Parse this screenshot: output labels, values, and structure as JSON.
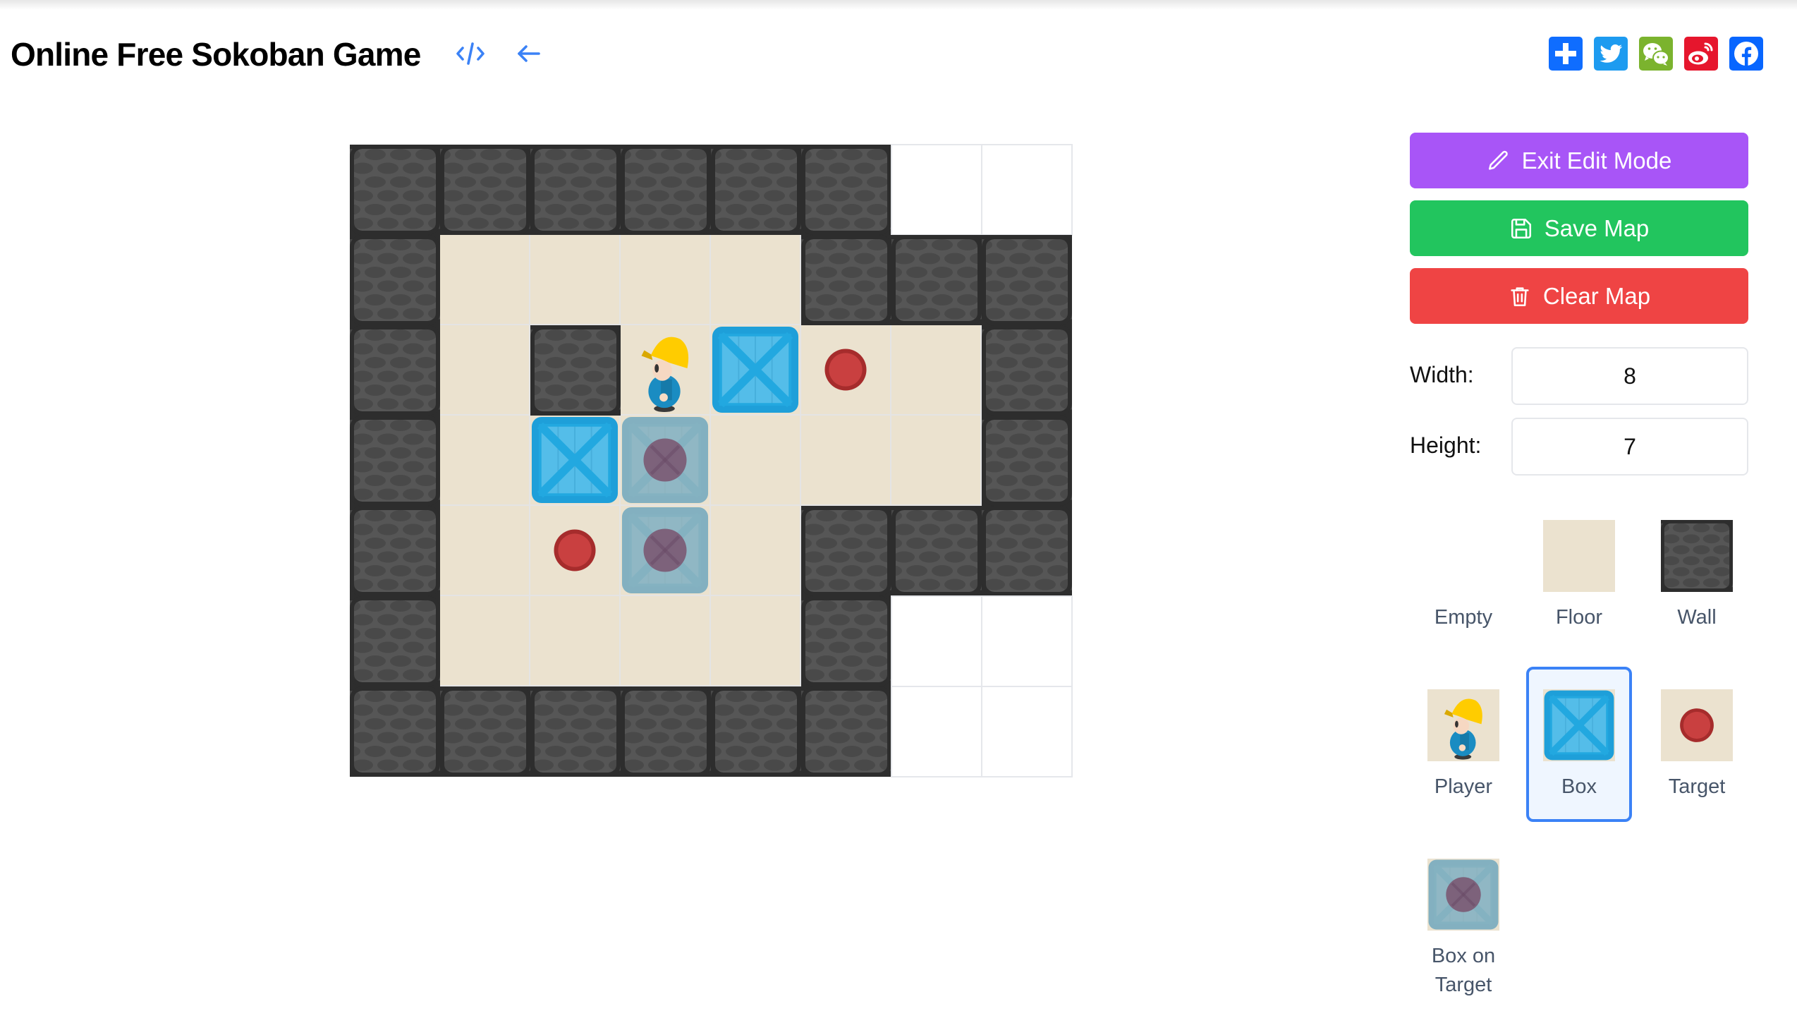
{
  "page": {
    "title": "Online Free Sokoban Game",
    "header_icons": [
      {
        "name": "code-icon",
        "color": "#3b82f6"
      },
      {
        "name": "back-arrow-icon",
        "color": "#3b82f6"
      }
    ],
    "share_icons": [
      {
        "name": "share-add-icon",
        "color": "#0f6dff"
      },
      {
        "name": "twitter-icon",
        "color": "#1d9bf0"
      },
      {
        "name": "wechat-icon",
        "color": "#7bb32e"
      },
      {
        "name": "weibo-icon",
        "color": "#e6162d"
      },
      {
        "name": "facebook-icon",
        "color": "#0866ff"
      }
    ]
  },
  "board": {
    "columns": 8,
    "rows": 7,
    "cells": [
      [
        "wall",
        "wall",
        "wall",
        "wall",
        "wall",
        "wall",
        "empty",
        "empty"
      ],
      [
        "wall",
        "floor",
        "floor",
        "floor",
        "floor",
        "wall",
        "wall",
        "wall"
      ],
      [
        "wall",
        "floor",
        "wall",
        "player",
        "box",
        "target",
        "floor",
        "wall"
      ],
      [
        "wall",
        "floor",
        "box",
        "box_on_target",
        "floor",
        "floor",
        "floor",
        "wall"
      ],
      [
        "wall",
        "floor",
        "target",
        "box_on_target",
        "floor",
        "wall",
        "wall",
        "wall"
      ],
      [
        "wall",
        "floor",
        "floor",
        "floor",
        "floor",
        "wall",
        "empty",
        "empty"
      ],
      [
        "wall",
        "wall",
        "wall",
        "wall",
        "wall",
        "wall",
        "empty",
        "empty"
      ]
    ]
  },
  "sidebar": {
    "buttons": {
      "exit_edit": {
        "label": "Exit Edit Mode",
        "icon": "pencil-icon",
        "color": "#a855f7"
      },
      "save": {
        "label": "Save Map",
        "icon": "save-icon",
        "color": "#22c55e"
      },
      "clear": {
        "label": "Clear Map",
        "icon": "trash-icon",
        "color": "#ef4444"
      }
    },
    "width_label": "Width:",
    "width_value": "8",
    "height_label": "Height:",
    "height_value": "7",
    "palette": [
      {
        "type": "empty",
        "label": "Empty",
        "selected": false
      },
      {
        "type": "floor",
        "label": "Floor",
        "selected": false
      },
      {
        "type": "wall",
        "label": "Wall",
        "selected": false
      },
      {
        "type": "player",
        "label": "Player",
        "selected": false
      },
      {
        "type": "box",
        "label": "Box",
        "selected": true
      },
      {
        "type": "target",
        "label": "Target",
        "selected": false
      },
      {
        "type": "box_on_target",
        "label": "Box on Target",
        "selected": false
      }
    ]
  }
}
